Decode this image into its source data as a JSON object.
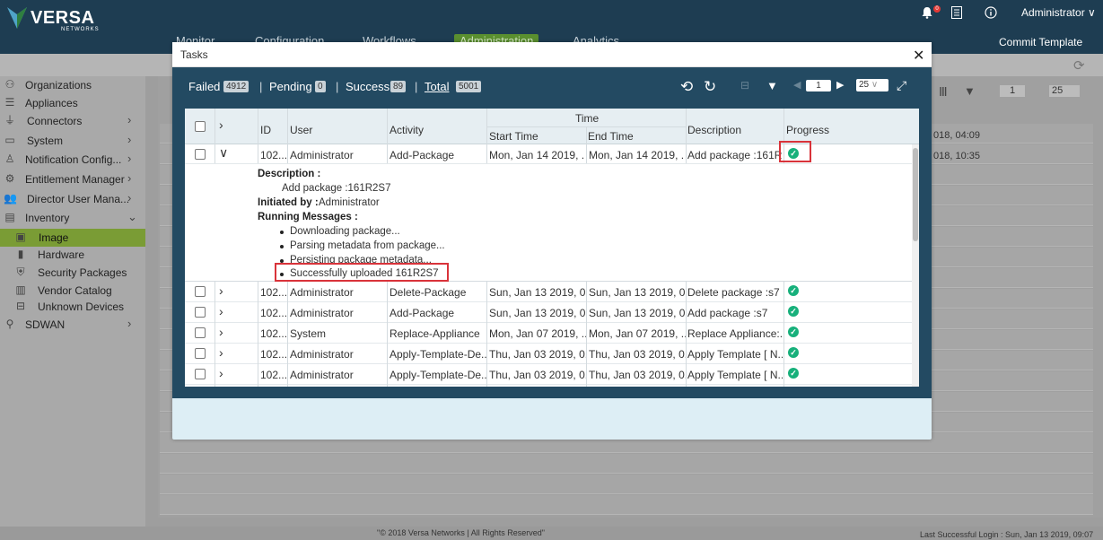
{
  "brand": {
    "name": "VERSA",
    "sub": "NETWORKS"
  },
  "topnav": [
    "Monitor",
    "Configuration",
    "Workflows",
    "Administration",
    "Analytics"
  ],
  "topright": {
    "notification_count": "0",
    "user": "Administrator",
    "commit": "Commit Template"
  },
  "sidebar": {
    "items": [
      {
        "label": "Organizations",
        "icon": "org-icon",
        "chevron": false,
        "indent": false
      },
      {
        "label": "Appliances",
        "icon": "appliance-icon",
        "chevron": false,
        "indent": false
      },
      {
        "label": "Connectors",
        "icon": "connector-icon",
        "chevron": true,
        "indent": false
      },
      {
        "label": "System",
        "icon": "system-icon",
        "chevron": true,
        "indent": false
      },
      {
        "label": "Notification Config...",
        "icon": "notification-icon",
        "chevron": true,
        "indent": false
      },
      {
        "label": "Entitlement Manager",
        "icon": "entitlement-icon",
        "chevron": true,
        "indent": false
      },
      {
        "label": "Director User Mana...",
        "icon": "users-icon",
        "chevron": true,
        "indent": false
      },
      {
        "label": "Inventory",
        "icon": "inventory-icon",
        "chevron": true,
        "indent": false
      },
      {
        "label": "Image",
        "icon": "image-icon",
        "chevron": false,
        "indent": true
      },
      {
        "label": "Hardware",
        "icon": "hardware-icon",
        "chevron": false,
        "indent": true
      },
      {
        "label": "Security Packages",
        "icon": "shield-icon",
        "chevron": false,
        "indent": true
      },
      {
        "label": "Vendor Catalog",
        "icon": "catalog-icon",
        "chevron": false,
        "indent": true
      },
      {
        "label": "Unknown Devices",
        "icon": "device-icon",
        "chevron": false,
        "indent": true
      },
      {
        "label": "SDWAN",
        "icon": "sdwan-icon",
        "chevron": true,
        "indent": false
      }
    ]
  },
  "background": {
    "times": [
      "018, 04:09",
      "018, 10:35"
    ],
    "page": "1",
    "size": "25"
  },
  "footer": {
    "copyright": "\"© 2018 Versa Networks | All Rights Reserved\"",
    "login": "Last Successful Login : Sun, Jan 13 2019, 09:07"
  },
  "modal": {
    "title": "Tasks",
    "counts": {
      "failed_label": "Failed",
      "failed": "4912",
      "pending_label": "Pending",
      "pending": "0",
      "success_label": "Success",
      "success": "89",
      "total_label": "Total",
      "total": "5001"
    },
    "pager": {
      "page": "1",
      "size": "25"
    },
    "columns": {
      "id": "ID",
      "user": "User",
      "activity": "Activity",
      "time": "Time",
      "start": "Start Time",
      "end": "End Time",
      "description": "Description",
      "progress": "Progress"
    },
    "expanded": {
      "id": "102...",
      "user": "Administrator",
      "activity": "Add-Package",
      "start": "Mon, Jan 14 2019, ...",
      "end": "Mon, Jan 14 2019, ...",
      "description": "Add package :161R...",
      "desc_label": "Description :",
      "desc_value": "Add package :161R2S7",
      "init_label": "Initiated by :",
      "init_value": "Administrator",
      "msg_label": "Running Messages :",
      "messages": [
        "Downloading package...",
        "Parsing metadata from package...",
        "Persisting package metadata...",
        "Successfully uploaded 161R2S7"
      ]
    },
    "rows": [
      {
        "id": "102...",
        "user": "Administrator",
        "activity": "Delete-Package",
        "start": "Sun, Jan 13 2019, 0...",
        "end": "Sun, Jan 13 2019, 0...",
        "description": "Delete package :s7"
      },
      {
        "id": "102...",
        "user": "Administrator",
        "activity": "Add-Package",
        "start": "Sun, Jan 13 2019, 0...",
        "end": "Sun, Jan 13 2019, 0...",
        "description": "Add package :s7"
      },
      {
        "id": "102...",
        "user": "System",
        "activity": "Replace-Appliance",
        "start": "Mon, Jan 07 2019, ...",
        "end": "Mon, Jan 07 2019, ...",
        "description": "Replace Appliance:..."
      },
      {
        "id": "102...",
        "user": "Administrator",
        "activity": "Apply-Template-De...",
        "start": "Thu, Jan 03 2019, 0...",
        "end": "Thu, Jan 03 2019, 0...",
        "description": "Apply Template [ N..."
      },
      {
        "id": "102...",
        "user": "Administrator",
        "activity": "Apply-Template-De...",
        "start": "Thu, Jan 03 2019, 0...",
        "end": "Thu, Jan 03 2019, 0...",
        "description": "Apply Template [ N..."
      }
    ]
  },
  "colors": {
    "topbar": "#1e3d52",
    "modal_body": "#234a62",
    "active_item": "#7a9c35",
    "success": "#17b07b",
    "highlight": "#d9333a"
  }
}
